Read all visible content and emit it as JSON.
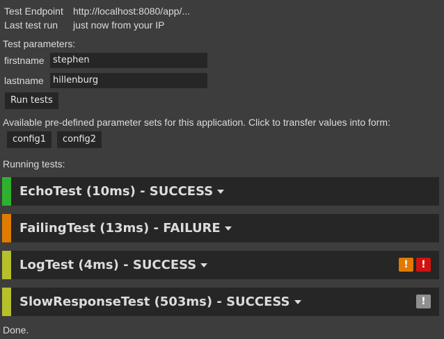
{
  "info": {
    "endpoint_label": "Test Endpoint",
    "endpoint_value": "http://localhost:8080/app/...",
    "lastrun_label": "Last test run",
    "lastrun_value": "just now from your IP"
  },
  "params": {
    "heading": "Test parameters:",
    "firstname_label": "firstname",
    "firstname_value": "stephen",
    "lastname_label": "lastname",
    "lastname_value": "hillenburg",
    "run_label": "Run tests"
  },
  "predefined": {
    "text": "Available pre-defined parameter sets for this application. Click to transfer values into form:",
    "configs": [
      "config1",
      "config2"
    ]
  },
  "running": {
    "heading": "Running tests:"
  },
  "tests": [
    {
      "title": "EchoTest (10ms) - SUCCESS",
      "status_color": "#2fb12f",
      "badges": []
    },
    {
      "title": "FailingTest (13ms) - FAILURE",
      "status_color": "#e07b00",
      "badges": []
    },
    {
      "title": "LogTest (4ms) - SUCCESS",
      "status_color": "#b6c02a",
      "badges": [
        {
          "glyph": "!",
          "color": "#e07b00",
          "icon": "warning-icon"
        },
        {
          "glyph": "!",
          "color": "#d11212",
          "icon": "error-icon"
        }
      ]
    },
    {
      "title": "SlowResponseTest (503ms) - SUCCESS",
      "status_color": "#b6c02a",
      "badges": [
        {
          "glyph": "!",
          "color": "#8f8f8f",
          "icon": "info-icon"
        }
      ]
    }
  ],
  "footer": {
    "status": "Done."
  }
}
